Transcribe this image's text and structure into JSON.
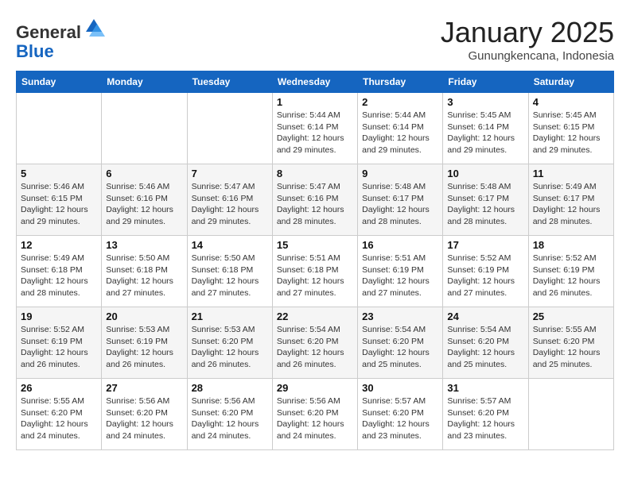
{
  "header": {
    "logo_general": "General",
    "logo_blue": "Blue",
    "title": "January 2025",
    "subtitle": "Gunungkencana, Indonesia"
  },
  "weekdays": [
    "Sunday",
    "Monday",
    "Tuesday",
    "Wednesday",
    "Thursday",
    "Friday",
    "Saturday"
  ],
  "weeks": [
    [
      {
        "day": "",
        "info": ""
      },
      {
        "day": "",
        "info": ""
      },
      {
        "day": "",
        "info": ""
      },
      {
        "day": "1",
        "info": "Sunrise: 5:44 AM\nSunset: 6:14 PM\nDaylight: 12 hours\nand 29 minutes."
      },
      {
        "day": "2",
        "info": "Sunrise: 5:44 AM\nSunset: 6:14 PM\nDaylight: 12 hours\nand 29 minutes."
      },
      {
        "day": "3",
        "info": "Sunrise: 5:45 AM\nSunset: 6:14 PM\nDaylight: 12 hours\nand 29 minutes."
      },
      {
        "day": "4",
        "info": "Sunrise: 5:45 AM\nSunset: 6:15 PM\nDaylight: 12 hours\nand 29 minutes."
      }
    ],
    [
      {
        "day": "5",
        "info": "Sunrise: 5:46 AM\nSunset: 6:15 PM\nDaylight: 12 hours\nand 29 minutes."
      },
      {
        "day": "6",
        "info": "Sunrise: 5:46 AM\nSunset: 6:16 PM\nDaylight: 12 hours\nand 29 minutes."
      },
      {
        "day": "7",
        "info": "Sunrise: 5:47 AM\nSunset: 6:16 PM\nDaylight: 12 hours\nand 29 minutes."
      },
      {
        "day": "8",
        "info": "Sunrise: 5:47 AM\nSunset: 6:16 PM\nDaylight: 12 hours\nand 28 minutes."
      },
      {
        "day": "9",
        "info": "Sunrise: 5:48 AM\nSunset: 6:17 PM\nDaylight: 12 hours\nand 28 minutes."
      },
      {
        "day": "10",
        "info": "Sunrise: 5:48 AM\nSunset: 6:17 PM\nDaylight: 12 hours\nand 28 minutes."
      },
      {
        "day": "11",
        "info": "Sunrise: 5:49 AM\nSunset: 6:17 PM\nDaylight: 12 hours\nand 28 minutes."
      }
    ],
    [
      {
        "day": "12",
        "info": "Sunrise: 5:49 AM\nSunset: 6:18 PM\nDaylight: 12 hours\nand 28 minutes."
      },
      {
        "day": "13",
        "info": "Sunrise: 5:50 AM\nSunset: 6:18 PM\nDaylight: 12 hours\nand 27 minutes."
      },
      {
        "day": "14",
        "info": "Sunrise: 5:50 AM\nSunset: 6:18 PM\nDaylight: 12 hours\nand 27 minutes."
      },
      {
        "day": "15",
        "info": "Sunrise: 5:51 AM\nSunset: 6:18 PM\nDaylight: 12 hours\nand 27 minutes."
      },
      {
        "day": "16",
        "info": "Sunrise: 5:51 AM\nSunset: 6:19 PM\nDaylight: 12 hours\nand 27 minutes."
      },
      {
        "day": "17",
        "info": "Sunrise: 5:52 AM\nSunset: 6:19 PM\nDaylight: 12 hours\nand 27 minutes."
      },
      {
        "day": "18",
        "info": "Sunrise: 5:52 AM\nSunset: 6:19 PM\nDaylight: 12 hours\nand 26 minutes."
      }
    ],
    [
      {
        "day": "19",
        "info": "Sunrise: 5:52 AM\nSunset: 6:19 PM\nDaylight: 12 hours\nand 26 minutes."
      },
      {
        "day": "20",
        "info": "Sunrise: 5:53 AM\nSunset: 6:19 PM\nDaylight: 12 hours\nand 26 minutes."
      },
      {
        "day": "21",
        "info": "Sunrise: 5:53 AM\nSunset: 6:20 PM\nDaylight: 12 hours\nand 26 minutes."
      },
      {
        "day": "22",
        "info": "Sunrise: 5:54 AM\nSunset: 6:20 PM\nDaylight: 12 hours\nand 26 minutes."
      },
      {
        "day": "23",
        "info": "Sunrise: 5:54 AM\nSunset: 6:20 PM\nDaylight: 12 hours\nand 25 minutes."
      },
      {
        "day": "24",
        "info": "Sunrise: 5:54 AM\nSunset: 6:20 PM\nDaylight: 12 hours\nand 25 minutes."
      },
      {
        "day": "25",
        "info": "Sunrise: 5:55 AM\nSunset: 6:20 PM\nDaylight: 12 hours\nand 25 minutes."
      }
    ],
    [
      {
        "day": "26",
        "info": "Sunrise: 5:55 AM\nSunset: 6:20 PM\nDaylight: 12 hours\nand 24 minutes."
      },
      {
        "day": "27",
        "info": "Sunrise: 5:56 AM\nSunset: 6:20 PM\nDaylight: 12 hours\nand 24 minutes."
      },
      {
        "day": "28",
        "info": "Sunrise: 5:56 AM\nSunset: 6:20 PM\nDaylight: 12 hours\nand 24 minutes."
      },
      {
        "day": "29",
        "info": "Sunrise: 5:56 AM\nSunset: 6:20 PM\nDaylight: 12 hours\nand 24 minutes."
      },
      {
        "day": "30",
        "info": "Sunrise: 5:57 AM\nSunset: 6:20 PM\nDaylight: 12 hours\nand 23 minutes."
      },
      {
        "day": "31",
        "info": "Sunrise: 5:57 AM\nSunset: 6:20 PM\nDaylight: 12 hours\nand 23 minutes."
      },
      {
        "day": "",
        "info": ""
      }
    ]
  ]
}
